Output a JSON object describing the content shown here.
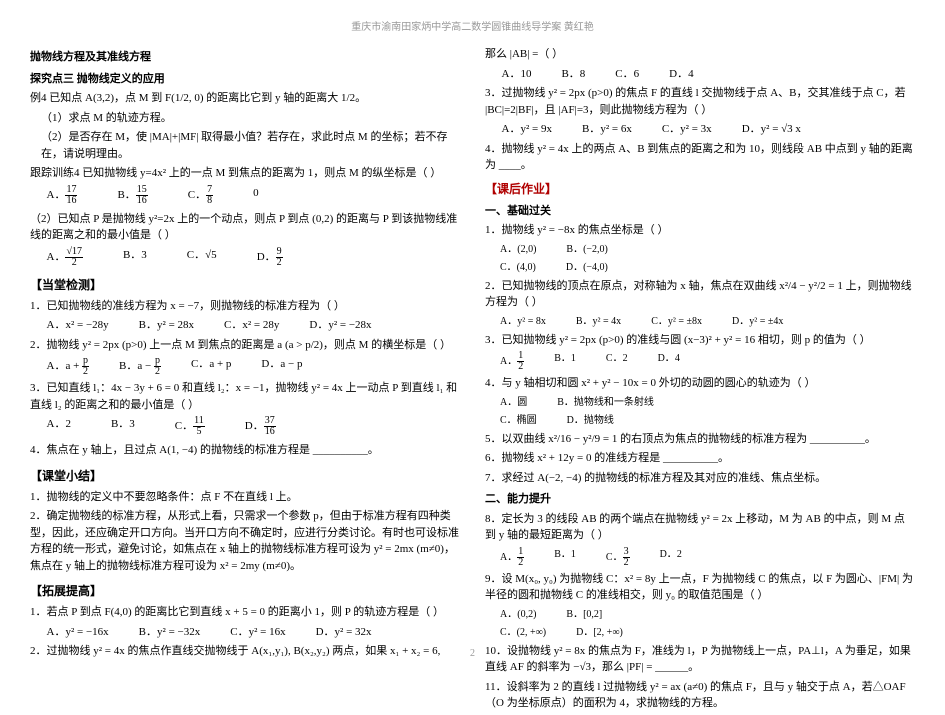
{
  "header": "重庆市渝南田家炳中学高二数学圆锥曲线导学案       黄红艳",
  "left": {
    "top_title": "抛物线方程及其准线方程",
    "tjd3": "探究点三  抛物线定义的应用",
    "ex4_line": "例4  已知点 A(3,2)，点 M 到 F(1/2, 0) 的距离比它到 y 轴的距离大 1/2。",
    "ex4_q1": "（1）求点 M 的轨迹方程。",
    "ex4_q2": "（2）是否存在 M，使 |MA|+|MF| 取得最小值？若存在，求此时点 M 的坐标；若不存在，请说明理由。",
    "ex4_follow": "跟踪训练4  已知抛物线 y=4x² 上的一点 M 到焦点的距离为 1，则点 M 的纵坐标是（   ）",
    "ex4_follow_opts": {
      "a": "17/16",
      "b": "15/16",
      "c": "7/8",
      "d": "0"
    },
    "ex4b": "（2）已知点 P 是抛物线 y²=2x 上的一个动点，则点 P 到点 (0,2) 的距离与 P 到该抛物线准线的距离之和的最小值是（   ）",
    "ex4b_opts": {
      "a": "√17 / 2",
      "b": "3",
      "c": "√5",
      "d": "9/2"
    },
    "dtjc": "【当堂检测】",
    "q1": "1．已知抛物线的准线方程为 x = −7，则抛物线的标准方程为（   ）",
    "q1_opts": {
      "a": "x² = −28y",
      "b": "y² = 28x",
      "c": "x² = 28y",
      "d": "y² = −28x"
    },
    "q2": "2．抛物线 y² = 2px (p>0) 上一点 M 到焦点的距离是 a (a > p/2)，则点 M 的横坐标是（   ）",
    "q2_opts": {
      "a": "a + p/2",
      "b": "a − p/2",
      "c": "a + p",
      "d": "a − p"
    },
    "q3": "3．已知直线 l₁：4x − 3y + 6 = 0 和直线 l₂：x = −1，抛物线 y² = 4x 上一动点 P 到直线 l₁ 和直线 l₂ 的距离之和的最小值是（   ）",
    "q3_opts": {
      "a": "2",
      "b": "3",
      "c": "11/5",
      "d": "37/16"
    },
    "q4": "4．焦点在 y 轴上，且过点 A(1, −4) 的抛物线的标准方程是 __________。",
    "ktxj": "【课堂小结】",
    "xj1": "1．抛物线的定义中不要忽略条件：点 F 不在直线 l 上。",
    "xj2": "2．确定抛物线的标准方程，从形式上看，只需求一个参数 p，但由于标准方程有四种类型，因此，还应确定开口方向。当开口方向不确定时，应进行分类讨论。有时也可设标准方程的统一形式，避免讨论，如焦点在 x 轴上的抛物线标准方程可设为 y² = 2mx (m≠0)，焦点在 y 轴上的抛物线标准方程可设为 x² = 2my (m≠0)。",
    "tztg": "【拓展提高】",
    "tz1": "1．若点 P 到点 F(4,0) 的距离比它到直线 x + 5 = 0 的距离小 1，则 P 的轨迹方程是（   ）",
    "tz1_opts": {
      "a": "y² = −16x",
      "b": "y² = −32x",
      "c": "y² = 16x",
      "d": "y² = 32x"
    },
    "tz2": "2．过抛物线 y² = 4x 的焦点作直线交抛物线于 A(x₁,y₁), B(x₂,y₂) 两点，如果 x₁ + x₂ = 6,"
  },
  "right": {
    "cont1": "那么 |AB| =（   ）",
    "cont1_opts": {
      "a": "10",
      "b": "8",
      "c": "6",
      "d": "4"
    },
    "q3r": "3．过抛物线 y² = 2px (p>0) 的焦点 F 的直线 l 交抛物线于点 A、B，交其准线于点 C，若 |BC|=2|BF|，且 |AF|=3，则此抛物线方程为（   ）",
    "q3r_opts": {
      "a": "y² = 9x",
      "b": "y² = 6x",
      "c": "y² = 3x",
      "d": "y² = √3 x"
    },
    "q4r": "4．抛物线 y² = 4x 上的两点 A、B 到焦点的距离之和为 10，则线段 AB 中点到 y 轴的距离为 ____。",
    "khzy": "【课后作业】",
    "jcgg": "一、基础过关",
    "h1": "1．抛物线 y² = −8x 的焦点坐标是（   ）",
    "h1_opts": {
      "a": "(2,0)",
      "b": "(−2,0)",
      "c": "(4,0)",
      "d": "(−4,0)"
    },
    "h2": "2．已知抛物线的顶点在原点，对称轴为 x 轴，焦点在双曲线 x²/4 − y²/2 = 1 上，则抛物线方程为（   ）",
    "h2_opts": {
      "a": "y² = 8x",
      "b": "y² = 4x",
      "c": "y² = ±8x",
      "d": "y² = ±4x"
    },
    "h3": "3．已知抛物线 y² = 2px (p>0) 的准线与圆 (x−3)² + y² = 16 相切，则 p 的值为（   ）",
    "h3_opts": {
      "a": "1/2",
      "b": "1",
      "c": "2",
      "d": "4"
    },
    "h4": "4．与 y 轴相切和圆 x² + y² − 10x = 0 外切的动圆的圆心的轨迹为（   ）",
    "h4_opts": {
      "a": "圆",
      "b": "抛物线和一条射线",
      "c": "椭圆",
      "d": "抛物线"
    },
    "h5": "5．以双曲线 x²/16 − y²/9 = 1 的右顶点为焦点的抛物线的标准方程为 __________。",
    "h6": "6．抛物线 x² + 12y = 0 的准线方程是 __________。",
    "h7": "7．求经过 A(−2, −4) 的抛物线的标准方程及其对应的准线、焦点坐标。",
    "nlts": "二、能力提升",
    "n8": "8．定长为 3 的线段 AB 的两个端点在抛物线 y² = 2x 上移动，M 为 AB 的中点，则 M 点到 y 轴的最短距离为（   ）",
    "n8_opts": {
      "a": "1/2",
      "b": "1",
      "c": "3/2",
      "d": "2"
    },
    "n9": "9．设 M(x₀, y₀) 为抛物线 C：x² = 8y 上一点，F 为抛物线 C 的焦点，以 F 为圆心、|FM| 为半径的圆和抛物线 C 的准线相交，则 y₀ 的取值范围是（   ）",
    "n9_opts": {
      "a": "(0,2)",
      "b": "[0,2]",
      "c": "(2, +∞)",
      "d": "[2, +∞)"
    },
    "n10": "10．设抛物线 y² = 8x 的焦点为 F，准线为 l，P 为抛物线上一点，PA⊥l，A 为垂足，如果直线 AF 的斜率为 −√3，那么 |PF| = ______。",
    "n11": "11．设斜率为 2 的直线 l 过抛物线 y² = ax (a≠0) 的焦点 F，且与 y 轴交于点 A，若△OAF（O 为坐标原点）的面积为 4，求抛物线的方程。"
  },
  "page_num": "2"
}
